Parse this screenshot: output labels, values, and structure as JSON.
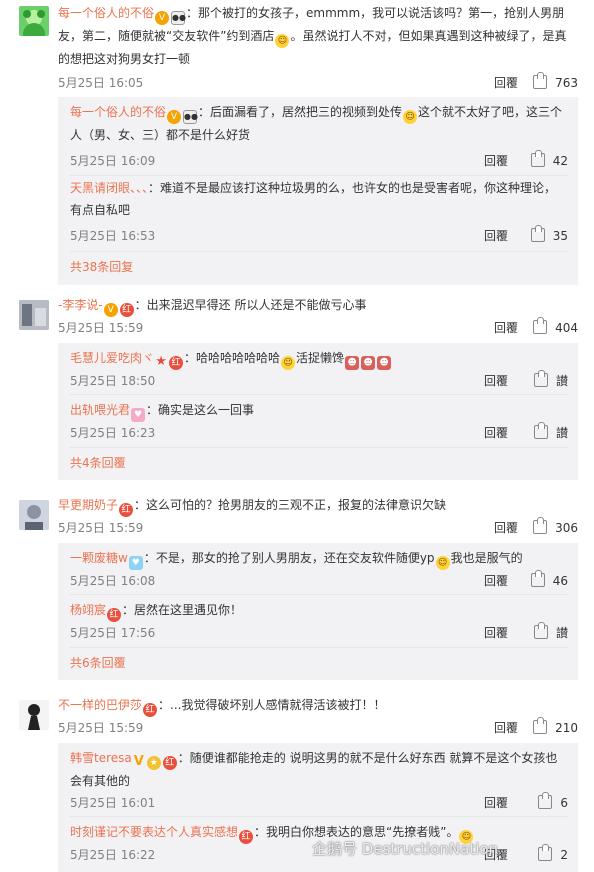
{
  "threads": [
    {
      "username": "每一个俗人的不俗",
      "text": "：那个被打的女孩子，emmmm，我可以说活该吗？第一，抢别人男朋友，第二，随便就被“交友软件”约到酒店",
      "text2": "。虽然说打人不对，但如果真遇到这种被绿了，是真的想把这对狗男女打一顿",
      "time": "5月25日 16:05",
      "reply_label": "回覆",
      "likes": "763",
      "replies": [
        {
          "username": "每一个俗人的不俗",
          "text": "：后面漏看了，居然把三的视频到处传",
          "text2": "这个就不太好了吧，这三个人（男、女、三）都不是什么好货",
          "time": "5月25日 16:09",
          "reply_label": "回覆",
          "likes": "42"
        },
        {
          "username": "天黑请闭眼、、、",
          "text": "：难道不是最应该打这种垃圾男的么，也许女的也是受害者呢，你这种理论，有点自私吧",
          "text2": "",
          "time": "5月25日 16:53",
          "reply_label": "回覆",
          "likes": "35"
        }
      ],
      "more_label": "共38条回复"
    },
    {
      "username": "-李李说-",
      "text": "：出来混迟早得还 所以人还是不能做亏心事",
      "text2": "",
      "time": "5月25日 15:59",
      "reply_label": "回覆",
      "likes": "404",
      "replies": [
        {
          "username": "毛慧儿爱吃肉ヾ",
          "text": "：哈哈哈哈哈哈哈",
          "text2": "活捉懒馋",
          "time": "5月25日 18:50",
          "reply_label": "回覆",
          "likes": "讃"
        },
        {
          "username": "出轨喂光君",
          "text": "：确实是这么一回事",
          "text2": "",
          "time": "5月25日 16:23",
          "reply_label": "回覆",
          "likes": "讃"
        }
      ],
      "more_label": "共4条回覆"
    },
    {
      "username": "早更期奶子",
      "text": "：这么可怕的？抢男朋友的三观不正，报复的法律意识欠缺",
      "text2": "",
      "time": "5月25日 15:59",
      "reply_label": "回覆",
      "likes": "306",
      "replies": [
        {
          "username": "一颗废糖w",
          "text": "：不是，那女的抢了别人男朋友，还在交友软件随便yp",
          "text2": "我也是服气的",
          "time": "5月25日 16:08",
          "reply_label": "回覆",
          "likes": "46"
        },
        {
          "username": "杨翊宸",
          "text": "：居然在这里遇见你！",
          "text2": "",
          "time": "5月25日 17:56",
          "reply_label": "回覆",
          "likes": "讃"
        }
      ],
      "more_label": "共6条回覆"
    },
    {
      "username": "不一样的巴伊莎",
      "text": "：...我觉得破坏别人感情就得活该被打！！",
      "text2": "",
      "time": "5月25日 15:59",
      "reply_label": "回覆",
      "likes": "210",
      "replies": [
        {
          "username": "韩雪teresa",
          "text": "：随便谁都能抢走的 说明这男的就不是什么好东西 就算不是这个女孩也会有其他的",
          "text2": "",
          "time": "5月25日 16:01",
          "reply_label": "回覆",
          "likes": "6"
        },
        {
          "username": "时刻谨记不要表达个人真实感想",
          "text": "：我明白你想表达的意思“先撩者贱”。",
          "text2": "",
          "time": "5月25日 16:22",
          "reply_label": "回覆",
          "likes": "2"
        }
      ],
      "more_label": ""
    }
  ],
  "watermark": "企鹅号 DestructionNation",
  "colors": {
    "username": "#eb7350",
    "subbg": "#f2f2f5"
  }
}
